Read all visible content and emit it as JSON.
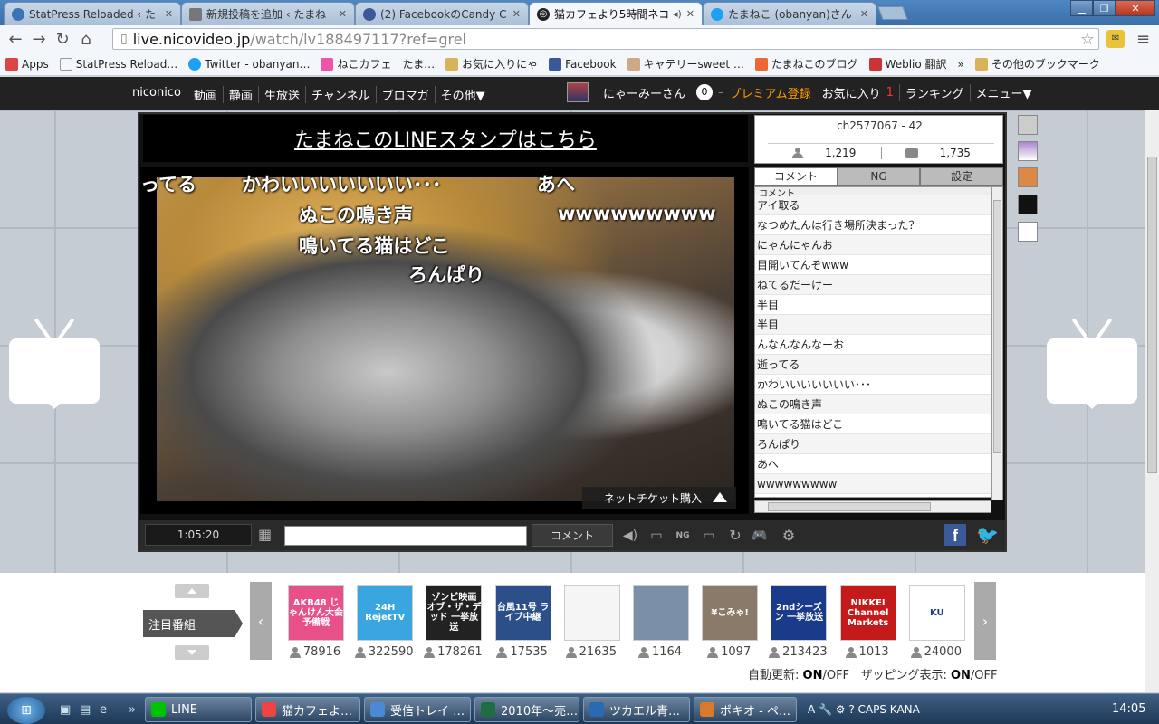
{
  "browser": {
    "tabs": [
      {
        "title": "StatPress Reloaded ‹ た",
        "color": "#3b74b4"
      },
      {
        "title": "新規投稿を追加 ‹ たまね",
        "color": "#777777"
      },
      {
        "title": "(2) FacebookのCandy C",
        "color": "#3b5998"
      },
      {
        "title": "猫カフェより5時間ネコ",
        "color": "#222222"
      },
      {
        "title": "たまねこ (obanyan)さん",
        "color": "#1da1f2"
      }
    ],
    "url_host": "live.nicovideo.jp",
    "url_path": "/watch/lv188497117?ref=grel",
    "bookmarks": [
      {
        "label": "Apps",
        "color": "#d44"
      },
      {
        "label": "StatPress Reload…",
        "color": "#999"
      },
      {
        "label": "Twitter - obanyan…",
        "color": "#1da1f2"
      },
      {
        "label": "ねこカフェ　たま…",
        "color": "#e5a"
      },
      {
        "label": "お気に入りにゃ",
        "color": "#d9b35a"
      },
      {
        "label": "Facebook",
        "color": "#3b5998"
      },
      {
        "label": "キャテリーsweet …",
        "color": "#ca8"
      },
      {
        "label": "たまねこのブログ",
        "color": "#e63"
      },
      {
        "label": "Weblio 翻訳",
        "color": "#c33"
      },
      {
        "label": "»",
        "color": ""
      },
      {
        "label": "その他のブックマーク",
        "color": "#d9b35a"
      }
    ]
  },
  "niconico": {
    "nav": [
      "niconico",
      "動画",
      "静画",
      "生放送",
      "チャンネル",
      "ブロマガ",
      "その他▼"
    ],
    "user": "にゃーみーさん",
    "points": "0",
    "dash": "–",
    "premium": "プレミアム登録",
    "favorites": "お気に入り",
    "fav_count": "1",
    "ranking": "ランキング",
    "menu": "メニュー▼"
  },
  "player": {
    "banner": "たまねこのLINEスタンプはこちら",
    "overlay_comments": [
      {
        "text": "ってる"
      },
      {
        "text": "かわいいいいいいい･･･"
      },
      {
        "text": "あへ"
      },
      {
        "text": "ぬこの鳴き声"
      },
      {
        "text": "wwwwwwwww"
      },
      {
        "text": "鳴いてる猫はどこ"
      },
      {
        "text": "ろんぱり"
      }
    ],
    "ticket": "ネットチケット購入",
    "time": "1:05:20",
    "comment_button": "コメント"
  },
  "panel": {
    "channel": "ch2577067 - 42",
    "viewers": "1,219",
    "comments": "1,735",
    "tabs": [
      "コメント",
      "NG",
      "設定"
    ],
    "list_header": "コメント",
    "comment_rows": [
      "アイ取る",
      "なつめたんは行き場所決まった？",
      "にゃんにゃんお",
      "目開いてんぞwww",
      "ねてるだーけー",
      "半目",
      "半目",
      "んなんなんなーお",
      "逝ってる",
      "かわいいいいいいい･･･",
      "ぬこの鳴き声",
      "鳴いてる猫はどこ",
      "ろんぱり",
      "あへ",
      "wwwwwwwww"
    ]
  },
  "featured": {
    "label": "注目番組",
    "items": [
      {
        "thumb": "AKB48 じゃんけん大会 予備戦",
        "count": "78916",
        "bg": "#e8508a"
      },
      {
        "thumb": "24H RejetTV",
        "count": "322590",
        "bg": "#3aa6e0"
      },
      {
        "thumb": "ゾンビ映画 オブ・ザ・デッド 一挙放送",
        "count": "178261",
        "bg": "#222222"
      },
      {
        "thumb": "台風11号 ライブ中継",
        "count": "17535",
        "bg": "#2c4f8a"
      },
      {
        "thumb": "",
        "count": "21635",
        "bg": "#f5f5f5"
      },
      {
        "thumb": "",
        "count": "1164",
        "bg": "#7a8fa8"
      },
      {
        "thumb": "¥こみゃ!",
        "count": "1097",
        "bg": "#8a7a6a"
      },
      {
        "thumb": "2ndシーズン 一挙放送",
        "count": "213423",
        "bg": "#1a3a8a"
      },
      {
        "thumb": "NIKKEI Channel Markets",
        "count": "1013",
        "bg": "#c41a1a"
      },
      {
        "thumb": "KU",
        "count": "24000",
        "bg": "#ffffff"
      }
    ],
    "auto_update": "自動更新:",
    "on": "ON",
    "off": "/OFF",
    "zapping": "ザッピング表示:"
  },
  "taskbar": {
    "items": [
      {
        "label": "LINE",
        "color": "#00c300"
      },
      {
        "label": "猫カフェよ…",
        "color": "#e44"
      },
      {
        "label": "受信トレイ …",
        "color": "#4a8ad4"
      },
      {
        "label": "2010年～売…",
        "color": "#1d6f42"
      },
      {
        "label": "ツカエル青…",
        "color": "#2a6ab0"
      },
      {
        "label": "ポキオ - ペ…",
        "color": "#d87a2a"
      }
    ],
    "tray": "A 🔧 ⚙ ? CAPS KANA",
    "clock": "14:05"
  }
}
